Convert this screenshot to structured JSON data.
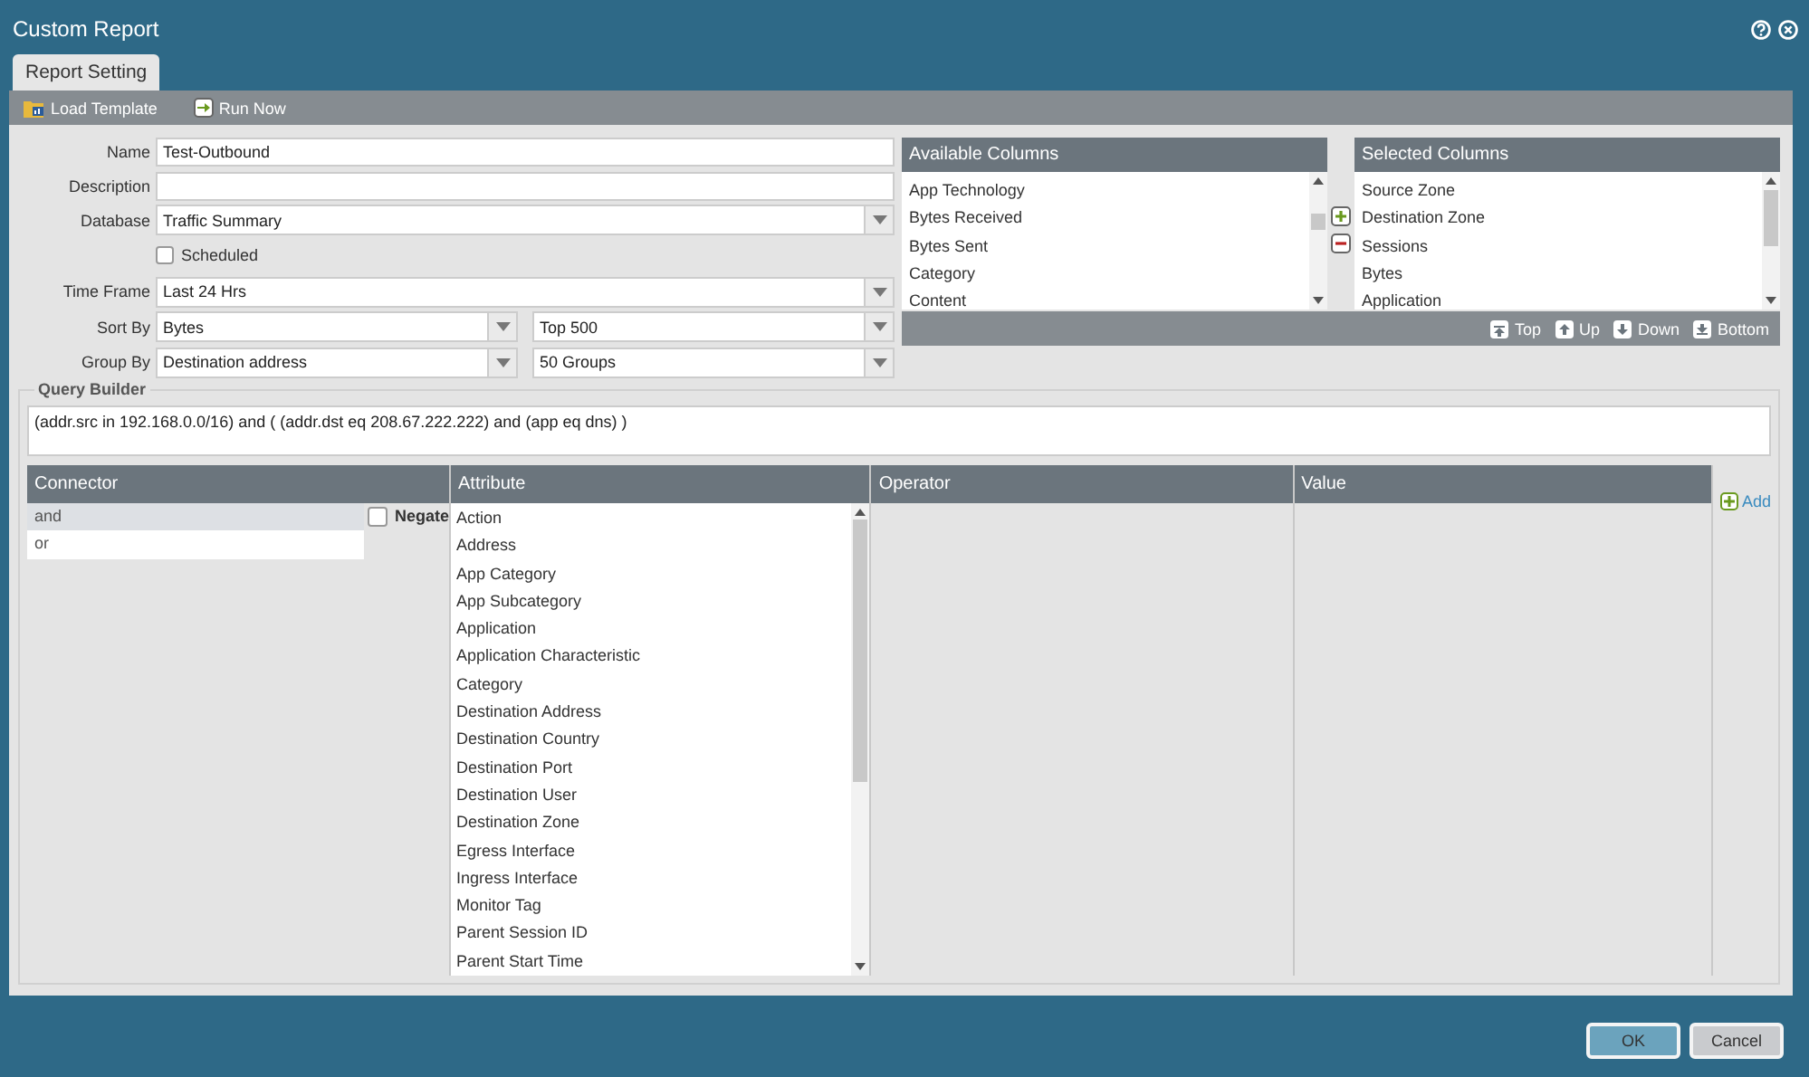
{
  "window": {
    "title": "Custom Report"
  },
  "tabs": [
    {
      "label": "Report Setting",
      "selected": true
    }
  ],
  "toolbar": [
    {
      "label": "Load Template",
      "kind": "load"
    },
    {
      "label": "Run Now",
      "kind": "run"
    }
  ],
  "form": {
    "name": {
      "label": "Name",
      "value": "Test-Outbound"
    },
    "description": {
      "label": "Description"
    },
    "database": {
      "label": "Database",
      "value": "Traffic Summary"
    },
    "scheduled": {
      "label": "Scheduled",
      "checked": false
    },
    "time_frame": {
      "label": "Time Frame",
      "value": "Last 24 Hrs"
    },
    "sort_by": {
      "label": "Sort By",
      "value": "Bytes",
      "value_2": "Top 500"
    },
    "group_by": {
      "label": "Group By",
      "value": "Destination address",
      "value_2": "50 Groups"
    }
  },
  "available_columns": {
    "title": "Available Columns",
    "items": [
      "App Technology",
      "Bytes Received",
      "Bytes Sent",
      "Category",
      "Content"
    ]
  },
  "selected_columns": {
    "title": "Selected Columns",
    "items": [
      "Source Zone",
      "Destination Zone",
      "Sessions",
      "Bytes",
      "Application"
    ]
  },
  "column_actions": [
    {
      "label": "Top",
      "kind": "top"
    },
    {
      "label": "Up",
      "kind": "up"
    },
    {
      "label": "Down",
      "kind": "down"
    },
    {
      "label": "Bottom",
      "kind": "bottom"
    }
  ],
  "query_builder": {
    "title": "Query Builder",
    "query": "(addr.src in 192.168.0.0/16) and ( (addr.dst eq 208.67.222.222) and (app eq dns) )",
    "columns": [
      "Connector",
      "Attribute",
      "Operator",
      "Value"
    ],
    "connectors": [
      {
        "label": "and",
        "selected": true
      },
      {
        "label": "or",
        "selected": false
      }
    ],
    "negate": {
      "label": "Negate",
      "checked": false
    },
    "attributes": [
      "Action",
      "Address",
      "App Category",
      "App Subcategory",
      "Application",
      "Application Characteristic",
      "Category",
      "Destination Address",
      "Destination Country",
      "Destination Port",
      "Destination User",
      "Destination Zone",
      "Egress Interface",
      "Ingress Interface",
      "Monitor Tag",
      "Parent Session ID",
      "Parent Start Time"
    ],
    "add_label": "Add"
  },
  "buttons": [
    {
      "label": "OK",
      "kind": "primary"
    },
    {
      "label": "Cancel",
      "kind": "secondary"
    }
  ]
}
